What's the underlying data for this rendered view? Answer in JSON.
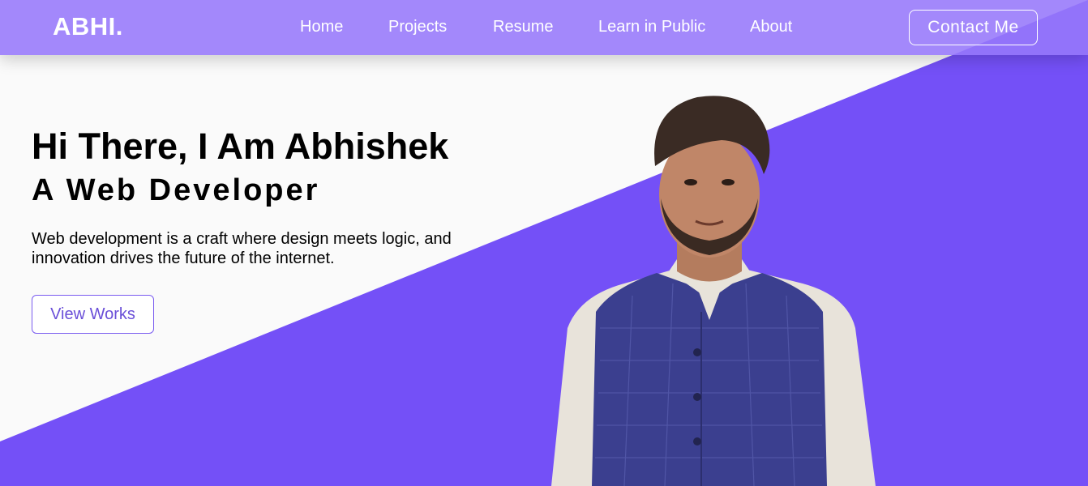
{
  "colors": {
    "accent": "#7450f7",
    "navbar": "#9678fa",
    "background": "#fafafa"
  },
  "navbar": {
    "brand": "ABHI.",
    "links": [
      {
        "label": "Home"
      },
      {
        "label": "Projects"
      },
      {
        "label": "Resume"
      },
      {
        "label": "Learn in Public"
      },
      {
        "label": "About"
      }
    ],
    "contact_label": "Contact Me"
  },
  "hero": {
    "title": "Hi There, I Am Abhishek",
    "subtitle": "A Web Developer",
    "description": "Web development is a craft where design meets logic, and innovation drives the future of the internet.",
    "cta_label": "View Works",
    "portrait_icon": "person-photo"
  }
}
